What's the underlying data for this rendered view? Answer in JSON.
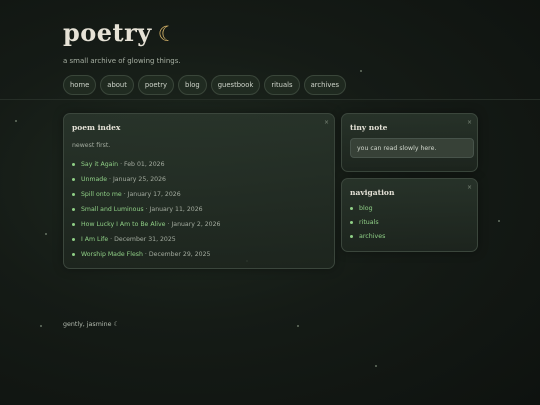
{
  "site": {
    "title": "poetry",
    "moon": "☾",
    "subtitle": "a small archive of glowing things."
  },
  "nav": [
    "home",
    "about",
    "poetry",
    "blog",
    "guestbook",
    "rituals",
    "archives"
  ],
  "poem_index": {
    "title": "poem index",
    "subtitle": "newest first.",
    "close_glyph": "×",
    "items": [
      {
        "title": "Say it Again",
        "date": "Feb 01, 2026"
      },
      {
        "title": "Unmade",
        "date": "January 25, 2026"
      },
      {
        "title": "Spill onto me",
        "date": "January 17, 2026"
      },
      {
        "title": "Small and Luminous",
        "date": "January 11, 2026"
      },
      {
        "title": "How Lucky I Am to Be Alive",
        "date": "January 2, 2026"
      },
      {
        "title": "I Am Life",
        "date": "December 31, 2025"
      },
      {
        "title": "Worship Made Flesh",
        "date": "December 29, 2025"
      }
    ]
  },
  "tiny_note": {
    "title": "tiny note",
    "text": "you can read slowly here.",
    "close_glyph": "×"
  },
  "navigation": {
    "title": "navigation",
    "close_glyph": "×",
    "items": [
      "blog",
      "rituals",
      "archives"
    ]
  },
  "footer": {
    "text": "gently, jasmine ☾"
  },
  "colors": {
    "accent": "#8fcf86",
    "moon": "#d8b56a",
    "background": "#151b16"
  }
}
